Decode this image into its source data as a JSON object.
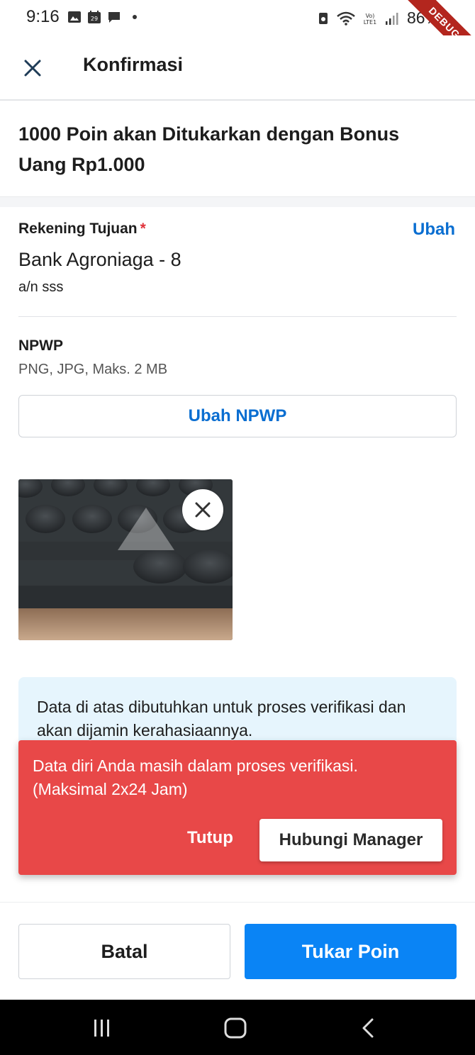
{
  "status_bar": {
    "time": "9:16",
    "battery": "86%",
    "left_icons": [
      "image-icon",
      "calendar-icon",
      "message-icon",
      "dot-icon"
    ],
    "right_icons": [
      "recycle-icon",
      "wifi-icon",
      "volte-icon",
      "signal-icon"
    ],
    "debug_banner": "DEBUG"
  },
  "app_bar": {
    "title": "Konfirmasi",
    "close_icon": "close-icon"
  },
  "headline": "1000 Poin akan Ditukarkan dengan Bonus Uang Rp1.000",
  "account": {
    "label": "Rekening Tujuan",
    "required_mark": "*",
    "change_label": "Ubah",
    "bank_name": "Bank Agroniaga - 8",
    "holder": "a/n sss"
  },
  "npwp": {
    "label": "NPWP",
    "hint": "PNG, JPG, Maks. 2 MB",
    "change_button": "Ubah NPWP",
    "remove_icon": "close-icon"
  },
  "info_box": {
    "text": "Data di atas dibutuhkan untuk proses verifikasi dan akan dijamin kerahasiaannya."
  },
  "snackbar": {
    "message": "Data diri Anda masih dalam proses verifikasi. (Maksimal 2x24 Jam)",
    "close_label": "Tutup",
    "action_label": "Hubungi Manager"
  },
  "bottom_bar": {
    "cancel_label": "Batal",
    "submit_label": "Tukar Poin"
  },
  "nav_bar": {
    "icons": [
      "recent-apps-icon",
      "home-icon",
      "back-icon"
    ]
  },
  "colors": {
    "primary": "#0a84f5",
    "link": "#0a6ed1",
    "snackbar": "#e84848",
    "info_bg": "#e6f5fd",
    "required": "#e0333b"
  }
}
